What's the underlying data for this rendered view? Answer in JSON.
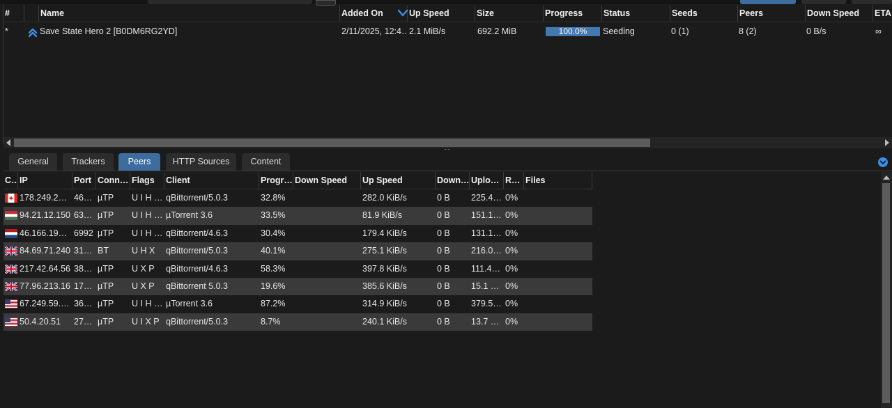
{
  "top_table": {
    "headers": [
      "#",
      "Name",
      "Added On",
      "Up Speed",
      "Size",
      "Progress",
      "Status",
      "Seeds",
      "Peers",
      "Down Speed",
      "ETA"
    ],
    "rows": [
      {
        "index": "*",
        "priority_icon": "double-chevron-up-icon",
        "name": "Save State Hero 2 [B0DM6RG2YD]",
        "added_on": "2/11/2025, 12:4…",
        "up_speed": "2.1 MiB/s",
        "size": "692.2 MiB",
        "progress_text": "100.0%",
        "progress": 1.0,
        "status": "Seeding",
        "seeds": "0 (1)",
        "peers": "8 (2)",
        "down_speed": "0 B/s",
        "eta": "∞"
      }
    ]
  },
  "tabs": [
    {
      "label": "General",
      "active": false
    },
    {
      "label": "Trackers",
      "active": false
    },
    {
      "label": "Peers",
      "active": true
    },
    {
      "label": "HTTP Sources",
      "active": false
    },
    {
      "label": "Content",
      "active": false
    }
  ],
  "peers_table": {
    "headers": [
      "C…",
      "IP",
      "Port",
      "Conn…",
      "Flags",
      "Client",
      "Progr…",
      "Down Speed",
      "Up Speed",
      "Down…",
      "Uplo…",
      "R…",
      "Files"
    ],
    "rows": [
      {
        "country": "canada",
        "ip": "178.249.21…",
        "port": "46…",
        "conn": "µTP",
        "flags": "U I H …",
        "client": "qBittorrent/5.0.3",
        "progress": "32.8%",
        "down_speed": "",
        "up_speed": "282.0 KiB/s",
        "downloaded": "0 B",
        "uploaded": "225.4 …",
        "relevance": "0%",
        "files": ""
      },
      {
        "country": "hungary",
        "ip": "94.21.12.150",
        "port": "63…",
        "conn": "µTP",
        "flags": "U I H …",
        "client": "µTorrent 3.6",
        "progress": "33.5%",
        "down_speed": "",
        "up_speed": "81.9 KiB/s",
        "downloaded": "0 B",
        "uploaded": "151.1 …",
        "relevance": "0%",
        "files": ""
      },
      {
        "country": "netherlands",
        "ip": "46.166.191.…",
        "port": "6992",
        "conn": "µTP",
        "flags": "U I H …",
        "client": "qBittorrent/4.6.3",
        "progress": "30.4%",
        "down_speed": "",
        "up_speed": "179.4 KiB/s",
        "downloaded": "0 B",
        "uploaded": "131.1 …",
        "relevance": "0%",
        "files": ""
      },
      {
        "country": "uk",
        "ip": "84.69.71.240",
        "port": "31…",
        "conn": "BT",
        "flags": "U H X",
        "client": "qBittorrent/5.0.3",
        "progress": "40.1%",
        "down_speed": "",
        "up_speed": "275.1 KiB/s",
        "downloaded": "0 B",
        "uploaded": "216.0 …",
        "relevance": "0%",
        "files": ""
      },
      {
        "country": "uk",
        "ip": "217.42.64.56",
        "port": "38…",
        "conn": "µTP",
        "flags": "U X P",
        "client": "qBittorrent/4.6.3",
        "progress": "58.3%",
        "down_speed": "",
        "up_speed": "397.8 KiB/s",
        "downloaded": "0 B",
        "uploaded": "111.4 …",
        "relevance": "0%",
        "files": ""
      },
      {
        "country": "uk",
        "ip": "77.96.213.16",
        "port": "17…",
        "conn": "µTP",
        "flags": "U X P",
        "client": "qBittorrent 5.0.3",
        "progress": "19.6%",
        "down_speed": "",
        "up_speed": "385.6 KiB/s",
        "downloaded": "0 B",
        "uploaded": "15.1 …",
        "relevance": "0%",
        "files": ""
      },
      {
        "country": "us",
        "ip": "67.249.59.1…",
        "port": "36…",
        "conn": "µTP",
        "flags": "U I H …",
        "client": "µTorrent 3.6",
        "progress": "87.2%",
        "down_speed": "",
        "up_speed": "314.9 KiB/s",
        "downloaded": "0 B",
        "uploaded": "379.5 …",
        "relevance": "0%",
        "files": ""
      },
      {
        "country": "us",
        "ip": "50.4.20.51",
        "port": "27…",
        "conn": "µTP",
        "flags": "U I X P",
        "client": "qBittorrent/5.0.3",
        "progress": "8.7%",
        "down_speed": "",
        "up_speed": "240.1 KiB/s",
        "downloaded": "0 B",
        "uploaded": "13.7 …",
        "relevance": "0%",
        "files": ""
      }
    ]
  },
  "colors": {
    "accent": "#3c6d9e",
    "progress_bar": "#4478b0",
    "background": "#1b1b1b",
    "row_alt": "#3a3a3a",
    "icon_blue": "#3d8fe6"
  }
}
